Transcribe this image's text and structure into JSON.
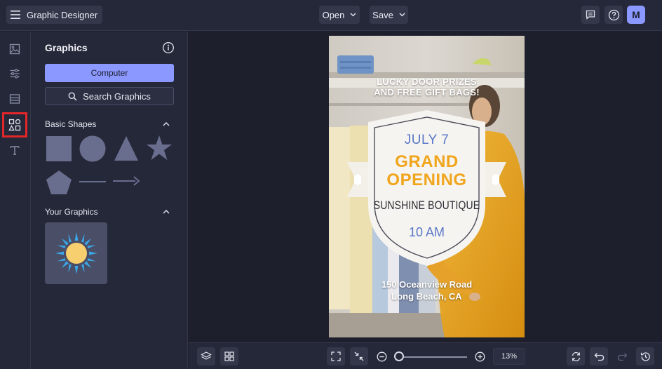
{
  "header": {
    "app_title": "Graphic Designer",
    "open_label": "Open",
    "save_label": "Save",
    "avatar_letter": "M"
  },
  "panel": {
    "title": "Graphics",
    "computer_label": "Computer",
    "search_label": "Search Graphics",
    "basic_shapes_title": "Basic Shapes",
    "your_graphics_title": "Your Graphics"
  },
  "poster": {
    "line1": "LUCKY DOOR PRIZES",
    "line2": "AND FREE GIFT BAGS!",
    "date": "JULY 7",
    "grand": "GRAND",
    "opening": "OPENING",
    "boutique": "SUNSHINE BOUTIQUE",
    "time": "10 AM",
    "address1": "150 Oceanview Road",
    "address2": "Long Beach, CA"
  },
  "zoom": {
    "value": "13%",
    "level": 0.13
  },
  "colors": {
    "accent": "#8a98ff",
    "highlight": "#e3262a",
    "poster_orange": "#f0a51c",
    "poster_blue": "#5a78c8"
  }
}
